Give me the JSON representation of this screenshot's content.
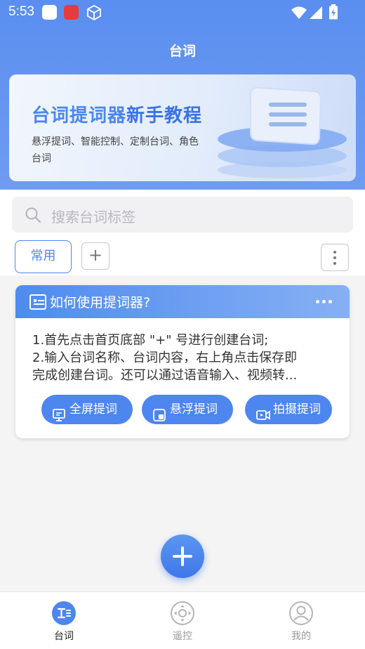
{
  "status_bar": {
    "time": "5:53"
  },
  "header": {
    "title": "台词"
  },
  "banner": {
    "title_part1": "台词提词器",
    "title_part2": "新手教程",
    "subtitle": "悬浮提词、智能控制、定制台词、角色台词"
  },
  "search": {
    "placeholder": "搜索台词标签"
  },
  "tags": {
    "active_label": "常用",
    "add_label": "+"
  },
  "card": {
    "title": "如何使用提词器?",
    "line1": "1.首先点击首页底部 \"+\" 号进行创建台词;",
    "line2": "2.输入台词名称、台词内容，右上角点击保存即",
    "line3": "完成创建台词。还可以通过语音输入、视频转...",
    "buttons": [
      {
        "label": "全屏提词",
        "icon": "screen-icon"
      },
      {
        "label": "悬浮提词",
        "icon": "float-window-icon"
      },
      {
        "label": "拍摄提词",
        "icon": "camera-video-icon"
      }
    ]
  },
  "tabbar": {
    "items": [
      {
        "label": "台词",
        "icon": "script-icon",
        "active": true
      },
      {
        "label": "遥控",
        "icon": "remote-control-icon",
        "active": false
      },
      {
        "label": "我的",
        "icon": "profile-icon",
        "active": false
      }
    ]
  },
  "colors": {
    "primary": "#4d86ee",
    "header": "#5a8ef0",
    "background": "#f4f4f4"
  }
}
